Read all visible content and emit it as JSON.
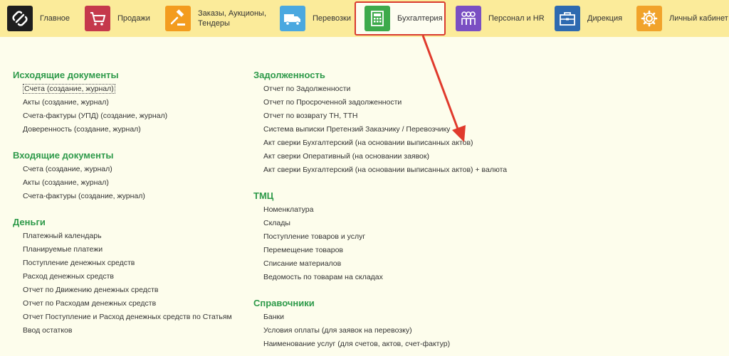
{
  "nav": {
    "items": [
      {
        "label": "Главное",
        "icon": "home-icon",
        "color": "#1e1e1e"
      },
      {
        "label": "Продажи",
        "icon": "cart-icon",
        "color": "#c5394c"
      },
      {
        "label": "Заказы,  Аукционы, Тендеры",
        "icon": "gavel-icon",
        "color": "#f39c1f"
      },
      {
        "label": "Перевозки",
        "icon": "truck-icon",
        "color": "#4aa8e0"
      },
      {
        "label": "Бухгалтерия",
        "icon": "calculator-icon",
        "color": "#3daa4b"
      },
      {
        "label": "Персонал и HR",
        "icon": "people-icon",
        "color": "#7a4fc3"
      },
      {
        "label": "Дирекция",
        "icon": "briefcase-icon",
        "color": "#2e6ab0"
      },
      {
        "label": "Личный кабинет",
        "icon": "gear-icon",
        "color": "#f1a32b"
      }
    ]
  },
  "left": {
    "sections": [
      {
        "title": "Исходящие документы",
        "links": [
          "Счета (создание, журнал)",
          "Акты (создание, журнал)",
          "Счета-фактуры (УПД) (создание, журнал)",
          "Доверенность (создание, журнал)"
        ]
      },
      {
        "title": "Входящие документы",
        "links": [
          "Счета (создание, журнал)",
          "Акты (создание, журнал)",
          "Счета-фактуры (создание, журнал)"
        ]
      },
      {
        "title": "Деньги",
        "links": [
          "Платежный календарь",
          "Планируемые платежи",
          "Поступление денежных средств",
          "Расход денежных средств",
          "Отчет по Движению денежных средств",
          "Отчет по Расходам денежных средств",
          "Отчет Поступление и Расход денежных средств по Статьям",
          "Ввод остатков"
        ]
      }
    ]
  },
  "right": {
    "sections": [
      {
        "title": "Задолженность",
        "links": [
          "Отчет по Задолженности",
          "Отчет по Просроченной задолженности",
          "Отчет по возврату ТН, ТТН",
          "Система выписки Претензий Заказчику / Перевозчику",
          "Акт сверки Бухгалтерский (на основании выписанных актов)",
          "Акт сверки Оперативный (на основании заявок)",
          "Акт сверки Бухгалтерский (на основании выписанных актов) + валюта"
        ]
      },
      {
        "title": "ТМЦ",
        "links": [
          "Номенклатура",
          "Склады",
          "Поступление товаров и услуг",
          "Перемещение товаров",
          "Списание материалов",
          "Ведомость по товарам на складах"
        ]
      },
      {
        "title": "Справочники",
        "links": [
          "Банки",
          "Условия оплаты (для заявок на перевозку)",
          "Наименование услуг (для счетов, актов, счет-фактур)"
        ]
      }
    ]
  },
  "colors": {
    "topbar": "#fbeb9a",
    "section_title": "#2e9a4a",
    "highlight": "#d93a2f",
    "background": "#fdfdec"
  }
}
